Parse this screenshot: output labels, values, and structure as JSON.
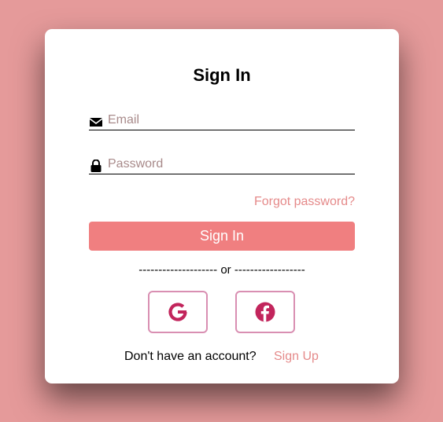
{
  "form": {
    "title": "Sign In",
    "email": {
      "placeholder": "Email",
      "value": "",
      "icon": "envelope-icon"
    },
    "password": {
      "placeholder": "Password",
      "value": "",
      "icon": "lock-icon"
    },
    "forgot_label": "Forgot password?",
    "submit_label": "Sign In",
    "divider_text": "-------------------- or ------------------",
    "social": [
      {
        "name": "google",
        "icon": "google-icon",
        "color": "#c2255c"
      },
      {
        "name": "facebook",
        "icon": "facebook-icon",
        "color": "#c2255c"
      }
    ],
    "footer_prompt": "Don't have an account?",
    "signup_label": "Sign Up"
  },
  "colors": {
    "background": "#e59a9a",
    "card": "#ffffff",
    "accent": "#f07f80",
    "link": "#e58a8a",
    "social_border": "#d98fb2",
    "social_icon": "#c2255c"
  }
}
